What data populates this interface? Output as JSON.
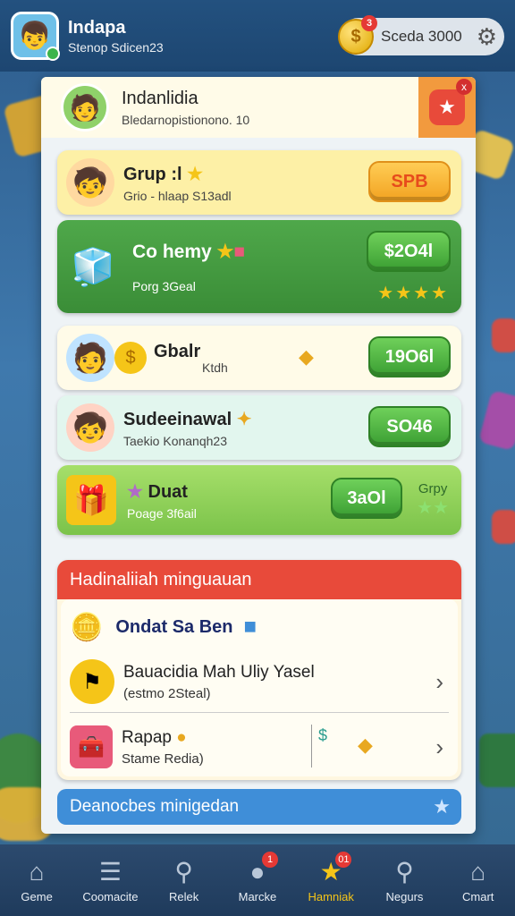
{
  "topbar": {
    "title": "Indapa",
    "subtitle": "Stenop Sdicen23",
    "currency_badge": "3",
    "currency_amount": "Sceda 3000"
  },
  "panel": {
    "header_title": "Indanlidia",
    "header_subtitle": "Bledarnopistionono. 10",
    "close_badge": "x"
  },
  "offers": [
    {
      "title": "Grup :l",
      "sub": "Grio - hlaap S13adl",
      "price": "SPB"
    },
    {
      "title": "Co hemy",
      "sub": "Porg 3Geal",
      "price": "$2O4l"
    },
    {
      "title": "Gbalr",
      "sub": "Ktdh",
      "price": "19O6l"
    },
    {
      "title": "Sudeeinawal",
      "sub": "Taekio Konanqh23",
      "price": "SO46"
    },
    {
      "title": "Duat",
      "sub": "Poage 3f6ail",
      "price": "3aOl",
      "extra": "Grpy"
    }
  ],
  "weekly": {
    "header": "Hadinaliiah minguauan",
    "items": [
      {
        "title": "Ondat Sa Ben"
      },
      {
        "title": "Bauacidia Mah Uliy Yasel",
        "sub": "(estmo 2Steal)"
      },
      {
        "title": "Rapap",
        "sub": "Stame Redia)"
      }
    ]
  },
  "more_button": "Deanocbes minigedan",
  "nav": [
    {
      "label": "Geme",
      "icon": "home-icon"
    },
    {
      "label": "Coomacite",
      "icon": "list-icon"
    },
    {
      "label": "Relek",
      "icon": "search-icon"
    },
    {
      "label": "Marcke",
      "icon": "chat-icon",
      "badge": "1"
    },
    {
      "label": "Hamniak",
      "icon": "star-icon",
      "badge": "01",
      "active": true
    },
    {
      "label": "Negurs",
      "icon": "magnifier-icon"
    },
    {
      "label": "Cmart",
      "icon": "house-icon"
    }
  ]
}
